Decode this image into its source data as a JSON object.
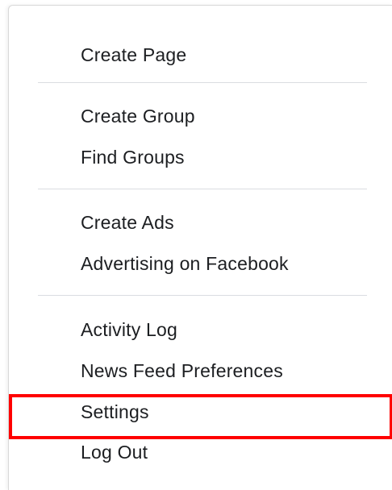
{
  "menu": {
    "items": [
      {
        "id": "create-page",
        "label": "Create Page"
      },
      {
        "id": "create-group",
        "label": "Create Group"
      },
      {
        "id": "find-groups",
        "label": "Find Groups"
      },
      {
        "id": "create-ads",
        "label": "Create Ads"
      },
      {
        "id": "advertising",
        "label": "Advertising on Facebook"
      },
      {
        "id": "activity-log",
        "label": "Activity Log"
      },
      {
        "id": "news-feed-preferences",
        "label": "News Feed Preferences"
      },
      {
        "id": "settings",
        "label": "Settings",
        "highlighted": true
      },
      {
        "id": "log-out",
        "label": "Log Out"
      }
    ]
  },
  "colors": {
    "text": "#1c1e21",
    "divider": "#dadde1",
    "highlight_border": "#ff0000"
  }
}
